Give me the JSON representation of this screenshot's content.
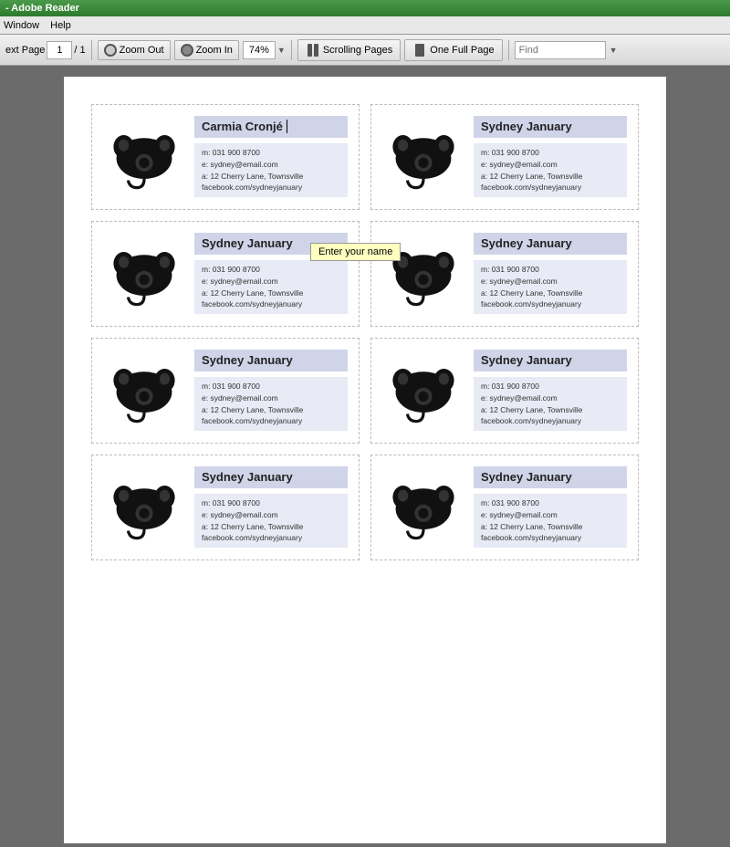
{
  "titleBar": {
    "text": "- Adobe Reader"
  },
  "menuBar": {
    "items": [
      "Window",
      "Help"
    ]
  },
  "toolbar": {
    "prevPage": "ext Page",
    "pageNum": "1",
    "pageTotal": "1",
    "zoomOut": "Zoom Out",
    "zoomIn": "Zoom In",
    "zoomValue": "74%",
    "scrollingPages": "Scrolling Pages",
    "oneFullPage": "One Full Page",
    "findPlaceholder": "Find"
  },
  "tooltip": "Enter your name",
  "cards": [
    {
      "id": 1,
      "name": "Carmia Cronjé",
      "isEditing": true,
      "phone": "m: 031 900 8700",
      "email": "e: sydney@email.com",
      "address": "a: 12 Cherry Lane, Townsville",
      "social": "facebook.com/sydneyjanuary"
    },
    {
      "id": 2,
      "name": "Sydney January",
      "isEditing": false,
      "phone": "m: 031 900 8700",
      "email": "e: sydney@email.com",
      "address": "a: 12 Cherry Lane, Townsville",
      "social": "facebook.com/sydneyjanuary"
    },
    {
      "id": 3,
      "name": "Sydney January",
      "isEditing": false,
      "phone": "m: 031 900 8700",
      "email": "e: sydney@email.com",
      "address": "a: 12 Cherry Lane, Townsville",
      "social": "facebook.com/sydneyjanuary"
    },
    {
      "id": 4,
      "name": "Sydney January",
      "isEditing": false,
      "phone": "m: 031 900 8700",
      "email": "e: sydney@email.com",
      "address": "a: 12 Cherry Lane, Townsville",
      "social": "facebook.com/sydneyjanuary"
    },
    {
      "id": 5,
      "name": "Sydney January",
      "isEditing": false,
      "phone": "m: 031 900 8700",
      "email": "e: sydney@email.com",
      "address": "a: 12 Cherry Lane, Townsville",
      "social": "facebook.com/sydneyjanuary"
    },
    {
      "id": 6,
      "name": "Sydney January",
      "isEditing": false,
      "phone": "m: 031 900 8700",
      "email": "e: sydney@email.com",
      "address": "a: 12 Cherry Lane, Townsville",
      "social": "facebook.com/sydneyjanuary"
    },
    {
      "id": 7,
      "name": "Sydney January",
      "isEditing": false,
      "phone": "m: 031 900 8700",
      "email": "e: sydney@email.com",
      "address": "a: 12 Cherry Lane, Townsville",
      "social": "facebook.com/sydneyjanuary"
    },
    {
      "id": 8,
      "name": "Sydney January",
      "isEditing": false,
      "phone": "m: 031 900 8700",
      "email": "e: sydney@email.com",
      "address": "a: 12 Cherry Lane, Townsville",
      "social": "facebook.com/sydneyjanuary"
    }
  ]
}
